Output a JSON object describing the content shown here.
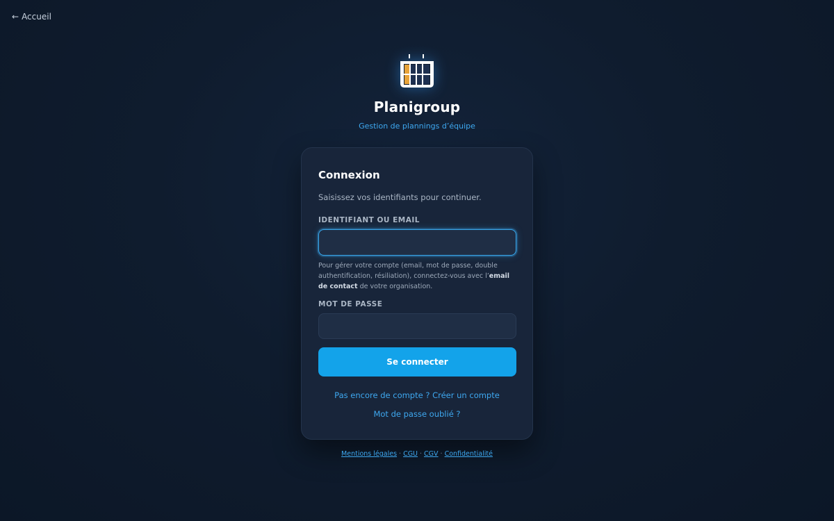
{
  "nav": {
    "back_arrow": "←",
    "back_label": "Accueil"
  },
  "brand": {
    "logo_icon": "calendar-grid-icon",
    "name": "Planigroup",
    "tagline": "Gestion de plannings d’équipe",
    "accent_color": "#3ea8f0",
    "logo_accent": "#e8a43a"
  },
  "login": {
    "title": "Connexion",
    "subtitle": "Saisissez vos identifiants pour continuer.",
    "identifier_label": "IDENTIFIANT OU EMAIL",
    "identifier_value": "",
    "help_text_pre": "Pour gérer votre compte (email, mot de passe, double authentification, résiliation), connectez-vous avec l’",
    "help_text_bold": "email de contact",
    "help_text_post": " de votre organisation.",
    "password_label": "MOT DE PASSE",
    "password_value": "",
    "submit_label": "Se connecter",
    "submit_color": "#13a3ea",
    "create_account_link": "Pas encore de compte ? Créer un compte",
    "forgot_password_link": "Mot de passe oublié ?"
  },
  "footer": {
    "separator": "·",
    "links": [
      "Mentions légales",
      "CGU",
      "CGV",
      "Confidentialité"
    ]
  }
}
